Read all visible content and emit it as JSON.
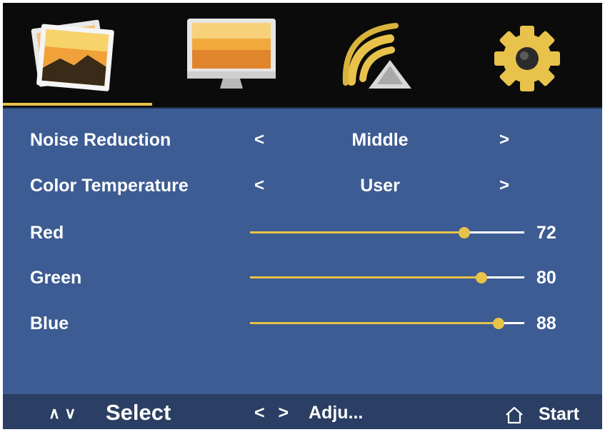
{
  "tabs": [
    {
      "icon": "picture-icon",
      "selected": true
    },
    {
      "icon": "monitor-icon",
      "selected": false
    },
    {
      "icon": "sound-icon",
      "selected": false
    },
    {
      "icon": "gear-icon",
      "selected": false
    }
  ],
  "settings": {
    "noise_reduction": {
      "label": "Noise Reduction",
      "left_arrow": "<",
      "value": "Middle",
      "right_arrow": ">"
    },
    "color_temperature": {
      "label": "Color Temperature",
      "left_arrow": "<",
      "value": "User",
      "right_arrow": ">"
    },
    "red": {
      "label": "Red",
      "value": "72",
      "level": 72
    },
    "green": {
      "label": "Green",
      "value": "80",
      "level": 80
    },
    "blue": {
      "label": "Blue",
      "value": "88",
      "level": 88
    }
  },
  "footer": {
    "select_arrows": "∧ ∨",
    "select_label": "Select",
    "adjust_arrows": "< >",
    "adjust_label": "Adju...",
    "start_label": "Start"
  },
  "colors": {
    "background": "#3d5c93",
    "accent": "#e8c24a",
    "tabbar": "#0b0b0b",
    "footer": "#2a3f63"
  }
}
